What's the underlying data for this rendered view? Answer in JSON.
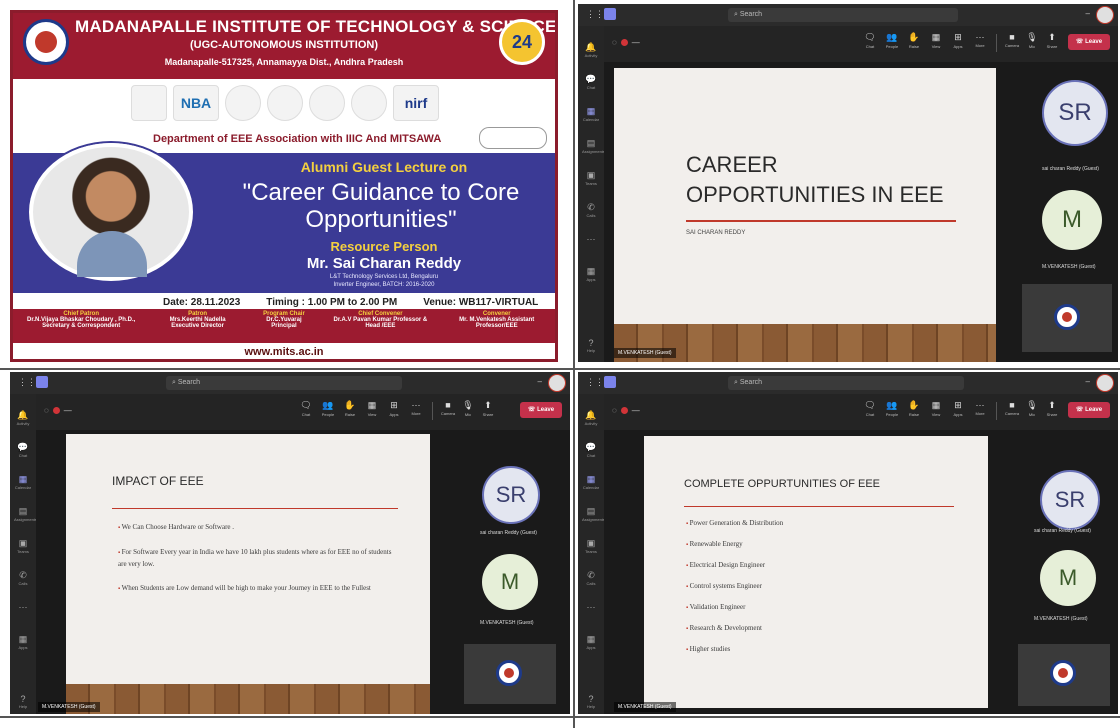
{
  "poster": {
    "title": "MADANAPALLE INSTITUTE OF TECHNOLOGY & SCIENCE",
    "subtitle": "(UGC-AUTONOMOUS INSTITUTION)",
    "address": "Madanapalle-517325, Annamayya Dist., Andhra Pradesh",
    "badge": "24",
    "accreditations": [
      "NBA",
      "nirf"
    ],
    "department_line": "Department of EEE Association with IIIC And MITSAWA",
    "alumni_heading": "Alumni Guest Lecture on",
    "lecture_title": "\"Career Guidance to Core Opportunities\"",
    "resource_label": "Resource Person",
    "resource_name": "Mr. Sai Charan Reddy",
    "resource_org": "L&T Technology Services Ltd, Bengaluru",
    "resource_role": "Inverter Engineer, BATCH: 2016-2020",
    "date": "Date: 28.11.2023",
    "timing": "Timing : 1.00 PM to 2.00 PM",
    "venue": "Venue: WB117-VIRTUAL",
    "people": [
      {
        "role": "Chief Patron",
        "name": "Dr.N.Vijaya Bhaskar Choudary , Ph.D., Secretary & Correspondent"
      },
      {
        "role": "Patron",
        "name": "Mrs.Keerthi Nadella Executive Director"
      },
      {
        "role": "Program Chair",
        "name": "Dr.C.Yuvaraj Principal"
      },
      {
        "role": "Chief Convener",
        "name": "Dr.A.V Pavan Kumar Professor & Head /EEE"
      },
      {
        "role": "Convener",
        "name": "Mr. M.Venkatesh Assistant Professor/EEE"
      }
    ],
    "website": "www.mits.ac.in"
  },
  "teams": {
    "search_placeholder": "Search",
    "leave_label": "Leave",
    "toolbar_buttons": [
      "Chat",
      "People",
      "Raise",
      "View",
      "Apps",
      "More",
      "Camera",
      "Mic",
      "Share"
    ],
    "rail_items": [
      "Activity",
      "Chat",
      "Calendar",
      "Assignments",
      "Teams",
      "Calls",
      "Apps",
      "Help"
    ],
    "participant_sr_initials": "SR",
    "participant_sr_name": "sai charan Reddy (Guest)",
    "participant_m_initials": "M",
    "participant_m_name": "M.VENKATESH (Guest)",
    "self_name_tag": "M.VENKATESH (Guest)"
  },
  "slides": {
    "s1_title": "CAREER OPPORTUNITIES IN EEE",
    "s1_subtitle": "SAI CHARAN REDDY",
    "s2_title": "IMPACT OF EEE",
    "s2_bullets": [
      "We Can Choose Hardware or Software .",
      "For Software Every year in India we have 10 lakh plus students where as for EEE no of students are very low.",
      "When Students are Low demand will be high to make your Journey in EEE to the Fullest"
    ],
    "s3_title": "COMPLETE OPPURTUNITIES OF EEE",
    "s3_bullets": [
      "Power Generation & Distribution",
      "Renewable Energy",
      "Electrical Design Engineer",
      "Control systems Engineer",
      "Validation Engineer",
      "Research & Development",
      "Higher studies"
    ]
  },
  "colors": {
    "maroon": "#9c1b30",
    "poster_blue": "#3b3a95",
    "accent_red": "#c0392b",
    "leave_red": "#c4314b"
  },
  "icons": [
    "grid-icon",
    "teams-logo-icon",
    "search-icon",
    "chat-icon",
    "people-icon",
    "raise-hand-icon",
    "view-icon",
    "apps-icon",
    "more-icon",
    "camera-icon",
    "mic-icon",
    "share-icon",
    "phone-icon"
  ]
}
